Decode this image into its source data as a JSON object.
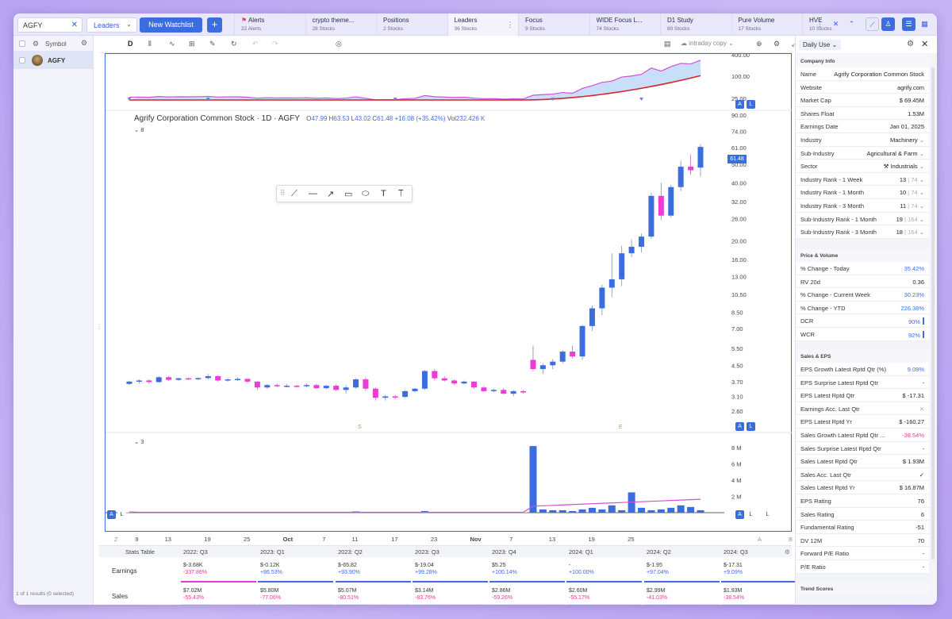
{
  "topbar": {
    "symbol_value": "AGFY",
    "watchlist_dropdown": "Leaders",
    "new_watchlist_label": "New Watchlist",
    "plus_label": "+",
    "tabs": [
      {
        "title": "Alerts",
        "sub": "22 Alerts",
        "flag": true
      },
      {
        "title": "crypto theme...",
        "sub": "28 Stocks"
      },
      {
        "title": "Positions",
        "sub": "2 Stocks"
      },
      {
        "title": "Leaders",
        "sub": "36 Stocks",
        "active": true
      },
      {
        "title": "Focus",
        "sub": "9 Stocks"
      },
      {
        "title": "WIDE Focus L...",
        "sub": "74 Stocks"
      },
      {
        "title": "D1 Study",
        "sub": "80 Stocks"
      },
      {
        "title": "Pure Volume",
        "sub": "17 Stocks"
      },
      {
        "title": "HVE",
        "sub": "10 Stocks"
      }
    ]
  },
  "leftpanel": {
    "column_label": "Symbol",
    "rows": [
      {
        "symbol": "AGFY"
      }
    ],
    "footer": "1 of 1 results (0 selected)"
  },
  "toolbar": {
    "timeframe": "D",
    "layout_select": "intraday copy"
  },
  "chart": {
    "title": "Agrify Corporation Common Stock · 1D · AGFY",
    "o_label": "O",
    "o_val": "47.99",
    "h_label": "H",
    "h_val": "63.53",
    "l_label": "L",
    "l_val": "43.02",
    "c_label": "C",
    "c_val": "61.48",
    "change": "+16.08 (+35.42%)",
    "vol_label": "Vol",
    "vol_val": "232.426 K",
    "price_panel_count": "8",
    "volume_panel_count": "3",
    "last_price": "61.48",
    "event_marks": [
      "S",
      "E"
    ],
    "pane_a": "A",
    "pane_l": "L",
    "x_axis_left": "Z",
    "x_axis_a": "A",
    "x_axis_b": "B",
    "colors": {
      "up": "#3b6ddf",
      "down": "#f03ad6",
      "ma_red": "#d6242a",
      "rs_pink": "#d24fd6",
      "fill_blue": "#bcd7f7"
    }
  },
  "chart_data": [
    {
      "type": "candlestick",
      "title": "Agrify Corporation Common Stock · 1D · AGFY",
      "scale": "log",
      "y_ticks": [
        "90.00",
        "74.00",
        "61.00",
        "50.00",
        "40.00",
        "32.00",
        "26.00",
        "20.00",
        "16.00",
        "13.00",
        "10.50",
        "8.50",
        "7.00",
        "5.50",
        "4.50",
        "3.70",
        "3.10",
        "2.60"
      ],
      "x_ticks": [
        "9",
        "13",
        "19",
        "25",
        "Oct",
        "7",
        "11",
        "17",
        "23",
        "Nov",
        "7",
        "13",
        "19",
        "25"
      ],
      "ohlc": [
        [
          3.6,
          3.75,
          3.55,
          3.7
        ],
        [
          3.7,
          3.8,
          3.62,
          3.75
        ],
        [
          3.75,
          3.8,
          3.6,
          3.68
        ],
        [
          3.68,
          3.95,
          3.65,
          3.9
        ],
        [
          3.9,
          3.95,
          3.72,
          3.78
        ],
        [
          3.78,
          3.88,
          3.72,
          3.85
        ],
        [
          3.85,
          3.9,
          3.78,
          3.82
        ],
        [
          3.82,
          3.9,
          3.75,
          3.86
        ],
        [
          3.86,
          4.05,
          3.8,
          3.95
        ],
        [
          3.95,
          4.0,
          3.7,
          3.75
        ],
        [
          3.75,
          3.85,
          3.7,
          3.8
        ],
        [
          3.8,
          3.9,
          3.72,
          3.82
        ],
        [
          3.82,
          3.85,
          3.65,
          3.7
        ],
        [
          3.7,
          3.72,
          3.35,
          3.45
        ],
        [
          3.45,
          3.6,
          3.4,
          3.55
        ],
        [
          3.55,
          3.62,
          3.45,
          3.5
        ],
        [
          3.5,
          3.6,
          3.45,
          3.52
        ],
        [
          3.52,
          3.56,
          3.46,
          3.5
        ],
        [
          3.5,
          3.62,
          3.45,
          3.55
        ],
        [
          3.55,
          3.6,
          3.4,
          3.42
        ],
        [
          3.42,
          3.55,
          3.38,
          3.52
        ],
        [
          3.52,
          3.58,
          3.3,
          3.35
        ],
        [
          3.35,
          3.55,
          3.2,
          3.45
        ],
        [
          3.45,
          3.85,
          3.4,
          3.8
        ],
        [
          3.8,
          3.9,
          3.3,
          3.4
        ],
        [
          3.4,
          3.45,
          2.95,
          3.05
        ],
        [
          3.05,
          3.15,
          2.95,
          3.1
        ],
        [
          3.1,
          3.15,
          3.0,
          3.08
        ],
        [
          3.08,
          3.35,
          3.05,
          3.3
        ],
        [
          3.3,
          3.42,
          3.25,
          3.4
        ],
        [
          3.4,
          4.25,
          3.35,
          4.2
        ],
        [
          4.2,
          4.3,
          3.75,
          3.85
        ],
        [
          3.85,
          3.95,
          3.7,
          3.75
        ],
        [
          3.75,
          3.8,
          3.55,
          3.62
        ],
        [
          3.62,
          3.75,
          3.58,
          3.7
        ],
        [
          3.7,
          3.72,
          3.4,
          3.45
        ],
        [
          3.45,
          3.5,
          3.28,
          3.3
        ],
        [
          3.3,
          3.4,
          3.25,
          3.35
        ],
        [
          3.35,
          3.42,
          3.18,
          3.2
        ],
        [
          3.2,
          3.35,
          3.1,
          3.3
        ],
        [
          3.3,
          3.35,
          3.2,
          3.25
        ],
        [
          4.8,
          5.7,
          4.2,
          4.3
        ],
        [
          4.3,
          4.6,
          4.05,
          4.5
        ],
        [
          4.5,
          4.85,
          4.3,
          4.7
        ],
        [
          4.7,
          5.4,
          4.6,
          5.3
        ],
        [
          5.3,
          5.7,
          4.9,
          5.0
        ],
        [
          5.0,
          7.3,
          4.8,
          7.2
        ],
        [
          7.2,
          9.2,
          6.8,
          8.9
        ],
        [
          8.9,
          11.8,
          8.2,
          11.4
        ],
        [
          11.4,
          17.2,
          10.2,
          12.6
        ],
        [
          12.6,
          18.8,
          11.6,
          17.2
        ],
        [
          17.2,
          20.3,
          16.4,
          18.6
        ],
        [
          18.6,
          21.8,
          17.4,
          21.0
        ],
        [
          21.0,
          35.5,
          20.4,
          34.2
        ],
        [
          34.2,
          40.0,
          25.6,
          27.0
        ],
        [
          27.0,
          39.0,
          26.4,
          38.0
        ],
        [
          38.0,
          52.0,
          36.2,
          48.5
        ],
        [
          48.5,
          56.0,
          44.0,
          46.5
        ],
        [
          47.99,
          63.53,
          43.02,
          61.48
        ]
      ],
      "moving_average": "red line (trend)",
      "relative_strength": "pink line"
    },
    {
      "type": "bar",
      "title": "Volume",
      "y_ticks": [
        "8 M",
        "6 M",
        "4 M",
        "2 M"
      ],
      "values_m": [
        0.05,
        0.05,
        0.05,
        0.05,
        0.05,
        0.05,
        0.05,
        0.05,
        0.05,
        0.05,
        0.05,
        0.05,
        0.05,
        0.05,
        0.05,
        0.05,
        0.05,
        0.05,
        0.05,
        0.05,
        0.05,
        0.05,
        0.05,
        0.15,
        0.05,
        0.05,
        0.05,
        0.05,
        0.05,
        0.05,
        0.2,
        0.05,
        0.05,
        0.05,
        0.05,
        0.05,
        0.05,
        0.05,
        0.05,
        0.05,
        0.05,
        8.2,
        0.4,
        0.3,
        0.3,
        0.2,
        0.4,
        0.6,
        0.4,
        0.9,
        0.3,
        2.5,
        0.6,
        0.3,
        0.4,
        0.6,
        0.9,
        0.7,
        0.3
      ]
    }
  ],
  "stats": {
    "title": "Stats Table",
    "quarters": [
      "2022: Q3",
      "2023: Q1",
      "2023: Q2",
      "2023: Q3",
      "2023: Q4",
      "2024: Q1",
      "2024: Q2",
      "2024: Q3"
    ],
    "earnings_label": "Earnings",
    "sales_label": "Sales",
    "earnings": [
      {
        "v": "$-3.68K",
        "p": "-337.86%",
        "c": "p"
      },
      {
        "v": "$-0.12K",
        "p": "+86.53%",
        "c": "g"
      },
      {
        "v": "$-65.82",
        "p": "+93.90%",
        "c": "g"
      },
      {
        "v": "$-19.04",
        "p": "+99.28%",
        "c": "g"
      },
      {
        "v": "$5.25",
        "p": "+100.14%",
        "c": "g"
      },
      {
        "v": "-",
        "p": "+100.00%",
        "c": "g"
      },
      {
        "v": "$-1.95",
        "p": "+97.04%",
        "c": "g"
      },
      {
        "v": "$-17.31",
        "p": "+9.09%",
        "c": "g"
      }
    ],
    "sales": [
      {
        "v": "$7.02M",
        "p": "-55.43%"
      },
      {
        "v": "$5.80M",
        "p": "-77.06%"
      },
      {
        "v": "$5.07M",
        "p": "-80.51%"
      },
      {
        "v": "$3.14M",
        "p": "-83.76%"
      },
      {
        "v": "$2.86M",
        "p": "-59.26%"
      },
      {
        "v": "$2.60M",
        "p": "-55.17%"
      },
      {
        "v": "$2.99M",
        "p": "-41.03%"
      },
      {
        "v": "$1.93M",
        "p": "-38.54%"
      }
    ]
  },
  "rightpanel": {
    "preset": "Daily Use",
    "company_info": {
      "title": "Company Info",
      "rows": [
        {
          "k": "Name",
          "v": "Agrify Corporation Common Stock"
        },
        {
          "k": "Website",
          "v": "agrify.com"
        },
        {
          "k": "Market Cap",
          "v": "$ 69.45M"
        },
        {
          "k": "Shares Float",
          "v": "1.53M"
        },
        {
          "k": "Earnings Date",
          "v": "Jan 01, 2025"
        },
        {
          "k": "Industry",
          "v": "Machinery"
        },
        {
          "k": "Sub-Industry",
          "v": "Agricultural & Farm"
        },
        {
          "k": "Sector",
          "v": "Industrials"
        },
        {
          "k": "Industry Rank - 1 Week",
          "v": "13",
          "d": "74"
        },
        {
          "k": "Industry Rank - 1 Month",
          "v": "10",
          "d": "74"
        },
        {
          "k": "Industry Rank - 3 Month",
          "v": "11",
          "d": "74"
        },
        {
          "k": "Sub-Industry Rank - 1 Month",
          "v": "19",
          "d": "164"
        },
        {
          "k": "Sub-Industry Rank - 3 Month",
          "v": "18",
          "d": "164"
        }
      ]
    },
    "price_volume": {
      "title": "Price & Volume",
      "rows": [
        {
          "k": "% Change - Today",
          "v": "35.42%"
        },
        {
          "k": "RV 20d",
          "v": "0.36"
        },
        {
          "k": "% Change - Current Week",
          "v": "30.23%"
        },
        {
          "k": "% Change - YTD",
          "v": "226.38%"
        },
        {
          "k": "DCR",
          "v": "90%"
        },
        {
          "k": "WCR",
          "v": "92%"
        }
      ]
    },
    "sales_eps": {
      "title": "Sales & EPS",
      "rows": [
        {
          "k": "EPS Growth Latest Rptd Qtr (%)",
          "v": "9.09%"
        },
        {
          "k": "EPS Surprise Latest Rptd Qtr",
          "v": "-"
        },
        {
          "k": "EPS Latest Rptd Qtr",
          "v": "$ -17.31"
        },
        {
          "k": "Earnings Acc. Last Qtr",
          "v": "✕"
        },
        {
          "k": "EPS Latest Rptd Yr",
          "v": "$ -160.27"
        },
        {
          "k": "Sales Growth Latest Rptd Qtr ...",
          "v": "-38.54%"
        },
        {
          "k": "Sales Surprise Latest Rptd Qtr",
          "v": "-"
        },
        {
          "k": "Sales Latest Rptd Qtr",
          "v": "$ 1.93M"
        },
        {
          "k": "Sales Acc. Last Qtr",
          "v": "✓"
        },
        {
          "k": "Sales Latest Rptd Yr",
          "v": "$ 16.87M"
        },
        {
          "k": "EPS Rating",
          "v": "76"
        },
        {
          "k": "Sales Rating",
          "v": "6"
        },
        {
          "k": "Fundamental Rating",
          "v": "-51"
        },
        {
          "k": "DV 12M",
          "v": "70"
        },
        {
          "k": "Forward P/E Ratio",
          "v": "-"
        },
        {
          "k": "P/E Ratio",
          "v": "-"
        }
      ]
    },
    "trend_scores": {
      "title": "Trend Scores"
    }
  }
}
